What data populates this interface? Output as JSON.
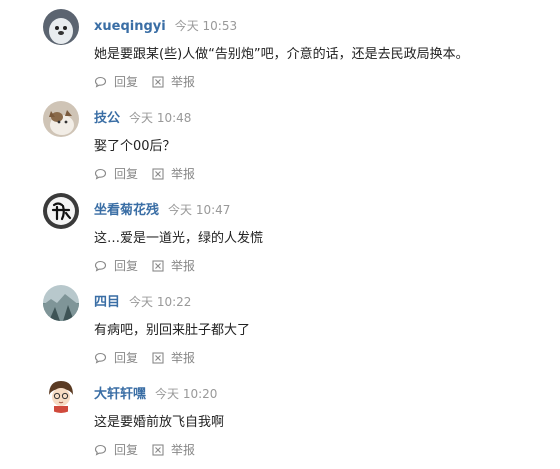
{
  "actions": {
    "reply_label": "回复",
    "report_label": "举报"
  },
  "comments": [
    {
      "username": "xueqingyi",
      "time": "今天 10:53",
      "text": "她是要跟某(些)人做“告别炮”吧，介意的话，还是去民政局换本。",
      "avatar_icon": "seal-avatar"
    },
    {
      "username": "技公",
      "time": "今天 10:48",
      "text": "娶了个00后？",
      "avatar_icon": "cat-avatar"
    },
    {
      "username": "坐看菊花残",
      "time": "今天 10:47",
      "text": "这…爱是一道光，绿的人发慌",
      "avatar_icon": "calligraphy-avatar"
    },
    {
      "username": "四目",
      "time": "今天 10:22",
      "text": "有病吧，别回来肚子都大了",
      "avatar_icon": "landscape-avatar"
    },
    {
      "username": "大轩轩嘿",
      "time": "今天 10:20",
      "text": "这是要婚前放飞自我啊",
      "avatar_icon": "anime-avatar"
    }
  ]
}
